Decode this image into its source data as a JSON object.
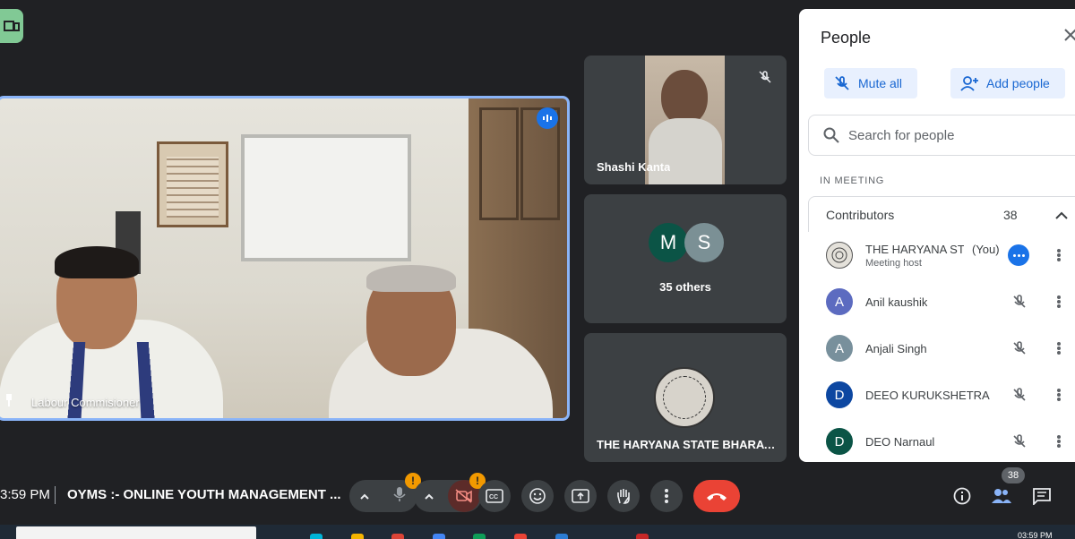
{
  "main": {
    "speaker_name": "Labour Commisioner"
  },
  "tiles": {
    "tile1_name": "Shashi Kanta",
    "tile2_avatar1": "M",
    "tile2_avatar2": "S",
    "tile2_label": "35 others",
    "tile3_name": "THE HARYANA STATE BHARAT..."
  },
  "panel": {
    "title": "People",
    "mute_all": "Mute all",
    "add_people": "Add people",
    "search_placeholder": "Search for people",
    "section_label": "IN MEETING",
    "group_label": "Contributors",
    "group_count": "38",
    "participants": [
      {
        "name": "THE HARYANA ST...",
        "you": "(You)",
        "sub": "Meeting host",
        "avatar": "",
        "avatar_color": "#e4e1da"
      },
      {
        "name": "Anil kaushik",
        "avatar": "A",
        "avatar_color": "#5c6bc0"
      },
      {
        "name": "Anjali Singh",
        "avatar": "A",
        "avatar_color": "#78909c"
      },
      {
        "name": "DEEO KURUKSHETRA",
        "avatar": "D",
        "avatar_color": "#0d47a1"
      },
      {
        "name": "DEO Narnaul",
        "avatar": "D",
        "avatar_color": "#0b5446"
      }
    ]
  },
  "bottom": {
    "time": "3:59 PM",
    "meeting_title": "OYMS :- ONLINE YOUTH MANAGEMENT ...",
    "people_count": "38"
  },
  "taskbar": {
    "clock": "03:59 PM"
  },
  "colors": {
    "accent": "#1a73e8",
    "end_call": "#ea4335",
    "warning": "#f29900",
    "active_border": "#8ab4f8"
  }
}
